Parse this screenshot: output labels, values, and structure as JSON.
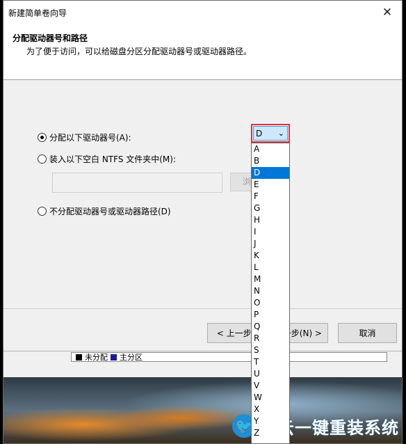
{
  "window": {
    "title": "新建简单卷向导",
    "close_glyph": "✕"
  },
  "header": {
    "title": "分配驱动器号和路径",
    "subtitle": "为了便于访问，可以给磁盘分区分配驱动器号或驱动器路径。"
  },
  "options": {
    "assign_letter": "分配以下驱动器号(A):",
    "mount_folder": "装入以下空白 NTFS 文件夹中(M):",
    "no_assign": "不分配驱动器号或驱动器路径(D)",
    "browse_label": "浏览(R)..."
  },
  "drive_select": {
    "value": "D",
    "arrow": "⌄",
    "options": [
      "A",
      "B",
      "D",
      "E",
      "F",
      "G",
      "H",
      "I",
      "J",
      "K",
      "L",
      "M",
      "N",
      "O",
      "P",
      "Q",
      "R",
      "S",
      "T",
      "U",
      "V",
      "W",
      "X",
      "Y",
      "Z"
    ]
  },
  "buttons": {
    "back": "< 上一步(B)",
    "next": "下一步(N) >",
    "cancel": "取消"
  },
  "legend": {
    "unallocated": "未分配",
    "primary": "主分区"
  },
  "watermark": {
    "text": "白云一键重装系统"
  },
  "colors": {
    "highlight": "#0078d7",
    "combo_border": "#e0303e"
  }
}
